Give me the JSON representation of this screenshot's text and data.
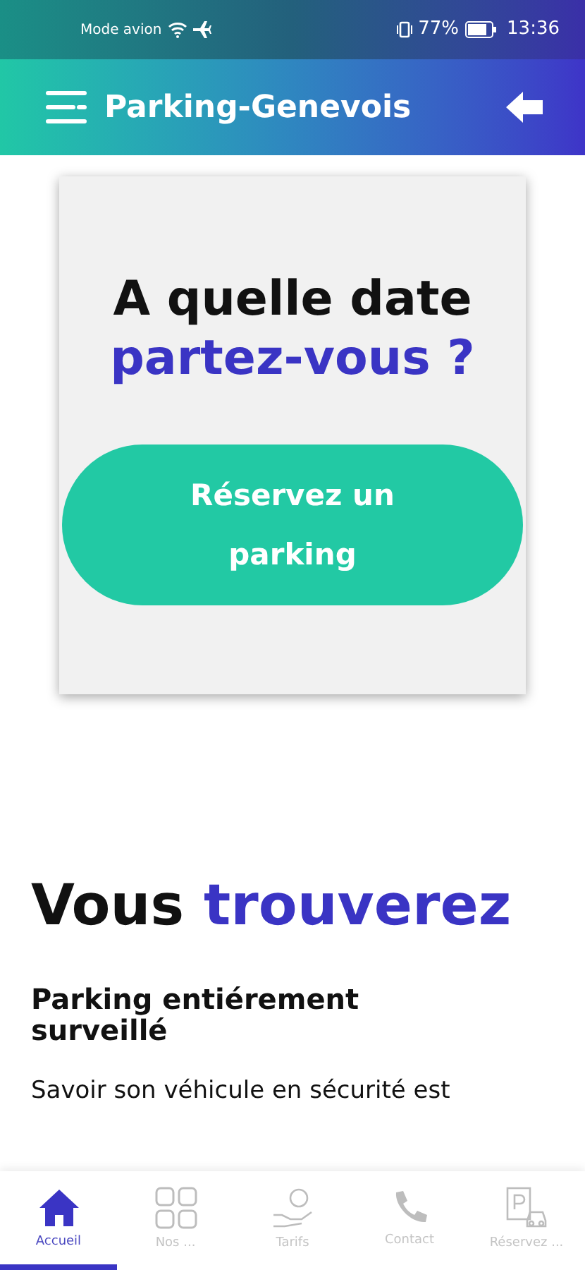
{
  "status_bar": {
    "left": "Mode avion",
    "battery": "77%",
    "time": "13:36"
  },
  "app_bar": {
    "title": "Parking-Genevois"
  },
  "hero": {
    "line_1": "A quelle date",
    "line_2": "partez-vous ?",
    "button": "Réservez un parking"
  },
  "section": {
    "title_1": "Vous",
    "title_2": "trouverez",
    "feature_title": "Parking entiérement surveillé",
    "feature_text": "Savoir son véhicule en sécurité est"
  },
  "tabs": [
    {
      "kind": "home",
      "label": "Accueil",
      "selected": true
    },
    {
      "kind": "grid",
      "label": "Nos ...",
      "selected": false
    },
    {
      "kind": "price",
      "label": "Tarifs",
      "selected": false
    },
    {
      "kind": "phone",
      "label": "Contact",
      "selected": false
    },
    {
      "kind": "book",
      "label": "Réservez ...",
      "selected": false
    }
  ]
}
